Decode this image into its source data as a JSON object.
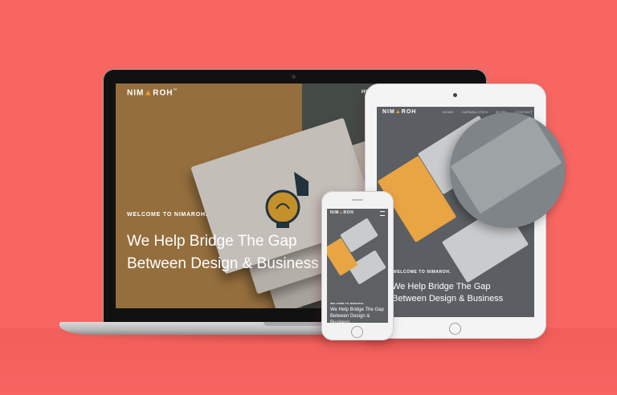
{
  "brand": {
    "name_parts": [
      "NIM",
      "▲",
      "ROH"
    ],
    "trademark": "™",
    "accent_color": "#f2a22a"
  },
  "background_color": "#f86662",
  "laptop": {
    "nav_label": "HOME",
    "welcome": "WELCOME TO NIMAROH.",
    "headline_line1": "We Help Bridge The Gap",
    "headline_line2": "Between Design & Business"
  },
  "tablet": {
    "nav_items": [
      "HOME",
      "CAPABILITIES",
      "WORK",
      "CONTACT"
    ],
    "welcome": "WELCOME TO NIMAROH.",
    "headline_line1": "We Help Bridge The Gap",
    "headline_line2": "Between Design & Business"
  },
  "phone": {
    "welcome": "WELCOME TO NIMAROH.",
    "headline_line1": "We Help Bridge The Gap",
    "headline_line2": "Between Design & Business"
  }
}
